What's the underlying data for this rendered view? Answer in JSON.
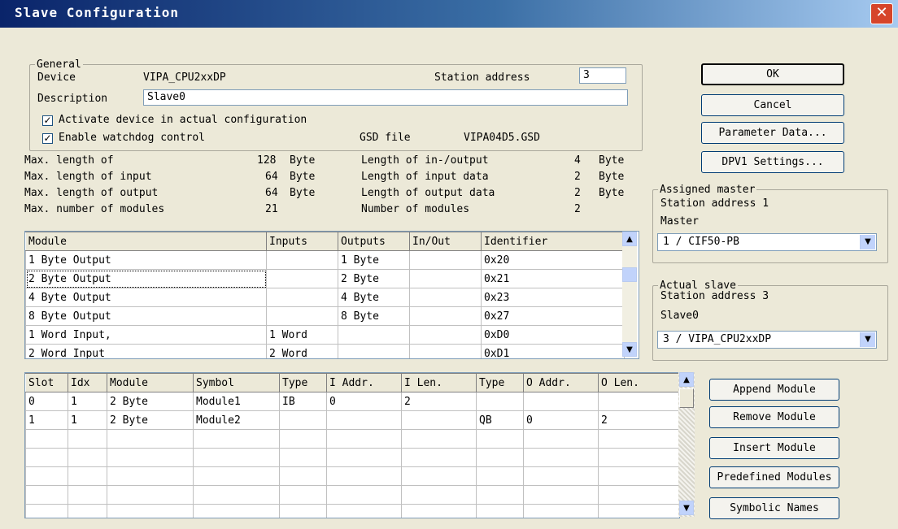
{
  "window": {
    "title": "Slave Configuration",
    "close_glyph": "✕"
  },
  "general": {
    "legend": "General",
    "device_label": "Device",
    "device_value": "VIPA_CPU2xxDP",
    "station_label": "Station address",
    "station_value": "3",
    "description_label": "Description",
    "description_value": "Slave0",
    "activate_label": "Activate device in actual configuration",
    "activate_checked": true,
    "watchdog_label": "Enable watchdog control",
    "watchdog_checked": true,
    "gsd_label": "GSD file",
    "gsd_value": "VIPA04D5.GSD"
  },
  "stats": {
    "left": [
      {
        "label": "Max. length of",
        "value": "128",
        "unit": "Byte"
      },
      {
        "label": "Max. length of input",
        "value": "64",
        "unit": "Byte"
      },
      {
        "label": "Max. length of output",
        "value": "64",
        "unit": "Byte"
      },
      {
        "label": "Max. number of modules",
        "value": "21",
        "unit": ""
      }
    ],
    "right": [
      {
        "label": "Length of in-/output",
        "value": "4",
        "unit": "Byte"
      },
      {
        "label": "Length of input data",
        "value": "2",
        "unit": "Byte"
      },
      {
        "label": "Length of output data",
        "value": "2",
        "unit": "Byte"
      },
      {
        "label": "Number of modules",
        "value": "2",
        "unit": ""
      }
    ]
  },
  "module_list": {
    "headers": [
      "Module",
      "Inputs",
      "Outputs",
      "In/Out",
      "Identifier"
    ],
    "rows": [
      [
        "1 Byte Output",
        "",
        "1 Byte",
        "",
        "0x20"
      ],
      [
        "2 Byte Output",
        "",
        "2 Byte",
        "",
        "0x21"
      ],
      [
        "4 Byte Output",
        "",
        "4 Byte",
        "",
        "0x23"
      ],
      [
        "8 Byte Output",
        "",
        "8 Byte",
        "",
        "0x27"
      ],
      [
        "1 Word Input,",
        "1 Word",
        "",
        "",
        "0xD0"
      ],
      [
        "2 Word Input",
        "2 Word",
        "",
        "",
        "0xD1"
      ]
    ]
  },
  "slot_table": {
    "headers": [
      "Slot",
      "Idx",
      "Module",
      "Symbol",
      "Type",
      "I Addr.",
      "I Len.",
      "Type",
      "O Addr.",
      "O Len."
    ],
    "rows": [
      [
        "0",
        "1",
        "2 Byte",
        "Module1",
        "IB",
        "0",
        "2",
        "",
        "",
        ""
      ],
      [
        "1",
        "1",
        "2 Byte",
        "Module2",
        "",
        "",
        "",
        "QB",
        "0",
        "2"
      ],
      [
        "",
        "",
        "",
        "",
        "",
        "",
        "",
        "",
        "",
        ""
      ],
      [
        "",
        "",
        "",
        "",
        "",
        "",
        "",
        "",
        "",
        ""
      ],
      [
        "",
        "",
        "",
        "",
        "",
        "",
        "",
        "",
        "",
        ""
      ],
      [
        "",
        "",
        "",
        "",
        "",
        "",
        "",
        "",
        "",
        ""
      ],
      [
        "",
        "",
        "",
        "",
        "",
        "",
        "",
        "",
        "",
        ""
      ]
    ]
  },
  "buttons": {
    "ok": "OK",
    "cancel": "Cancel",
    "parameter": "Parameter Data...",
    "dpv1": "DPV1 Settings...",
    "append": "Append Module",
    "remove": "Remove Module",
    "insert": "Insert Module",
    "predefined": "Predefined Modules",
    "symbolic": "Symbolic Names"
  },
  "assigned_master": {
    "legend": "Assigned master",
    "station_text": "Station address 1",
    "master_label": "Master",
    "master_value": "1 / CIF50-PB"
  },
  "actual_slave": {
    "legend": "Actual slave",
    "station_text": "Station address 3",
    "slave_label": "Slave0",
    "slave_value": "3 / VIPA_CPU2xxDP"
  },
  "colors": {
    "title_start": "#0a246a",
    "title_end": "#a6caf0",
    "close": "#d6452a",
    "face": "#ece9d8"
  }
}
